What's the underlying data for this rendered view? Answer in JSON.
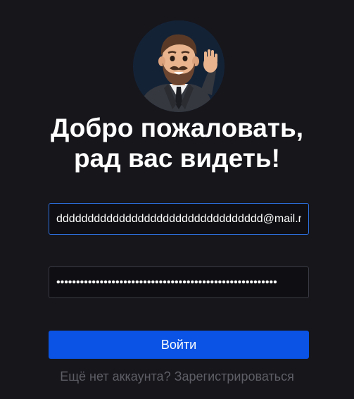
{
  "avatar": {
    "icon": "waving-man-avatar-icon"
  },
  "title": {
    "line1": "Добро пожаловать,",
    "line2": "рад вас видеть!"
  },
  "form": {
    "email_value": "ddddddddddddddddddddddddddddddddd@mail.ru",
    "password_value": "••••••••••••••••••••••••••••••••••••••••••••••••••••••••"
  },
  "login_button": "Войти",
  "register": {
    "prompt": "Ещё нет аккаунта?",
    "link": "Зарегистрироваться"
  },
  "colors": {
    "background": "#17161b",
    "accent": "#0a53e4",
    "focus_border": "#2d6fe0",
    "muted_text": "#5e5e66"
  }
}
